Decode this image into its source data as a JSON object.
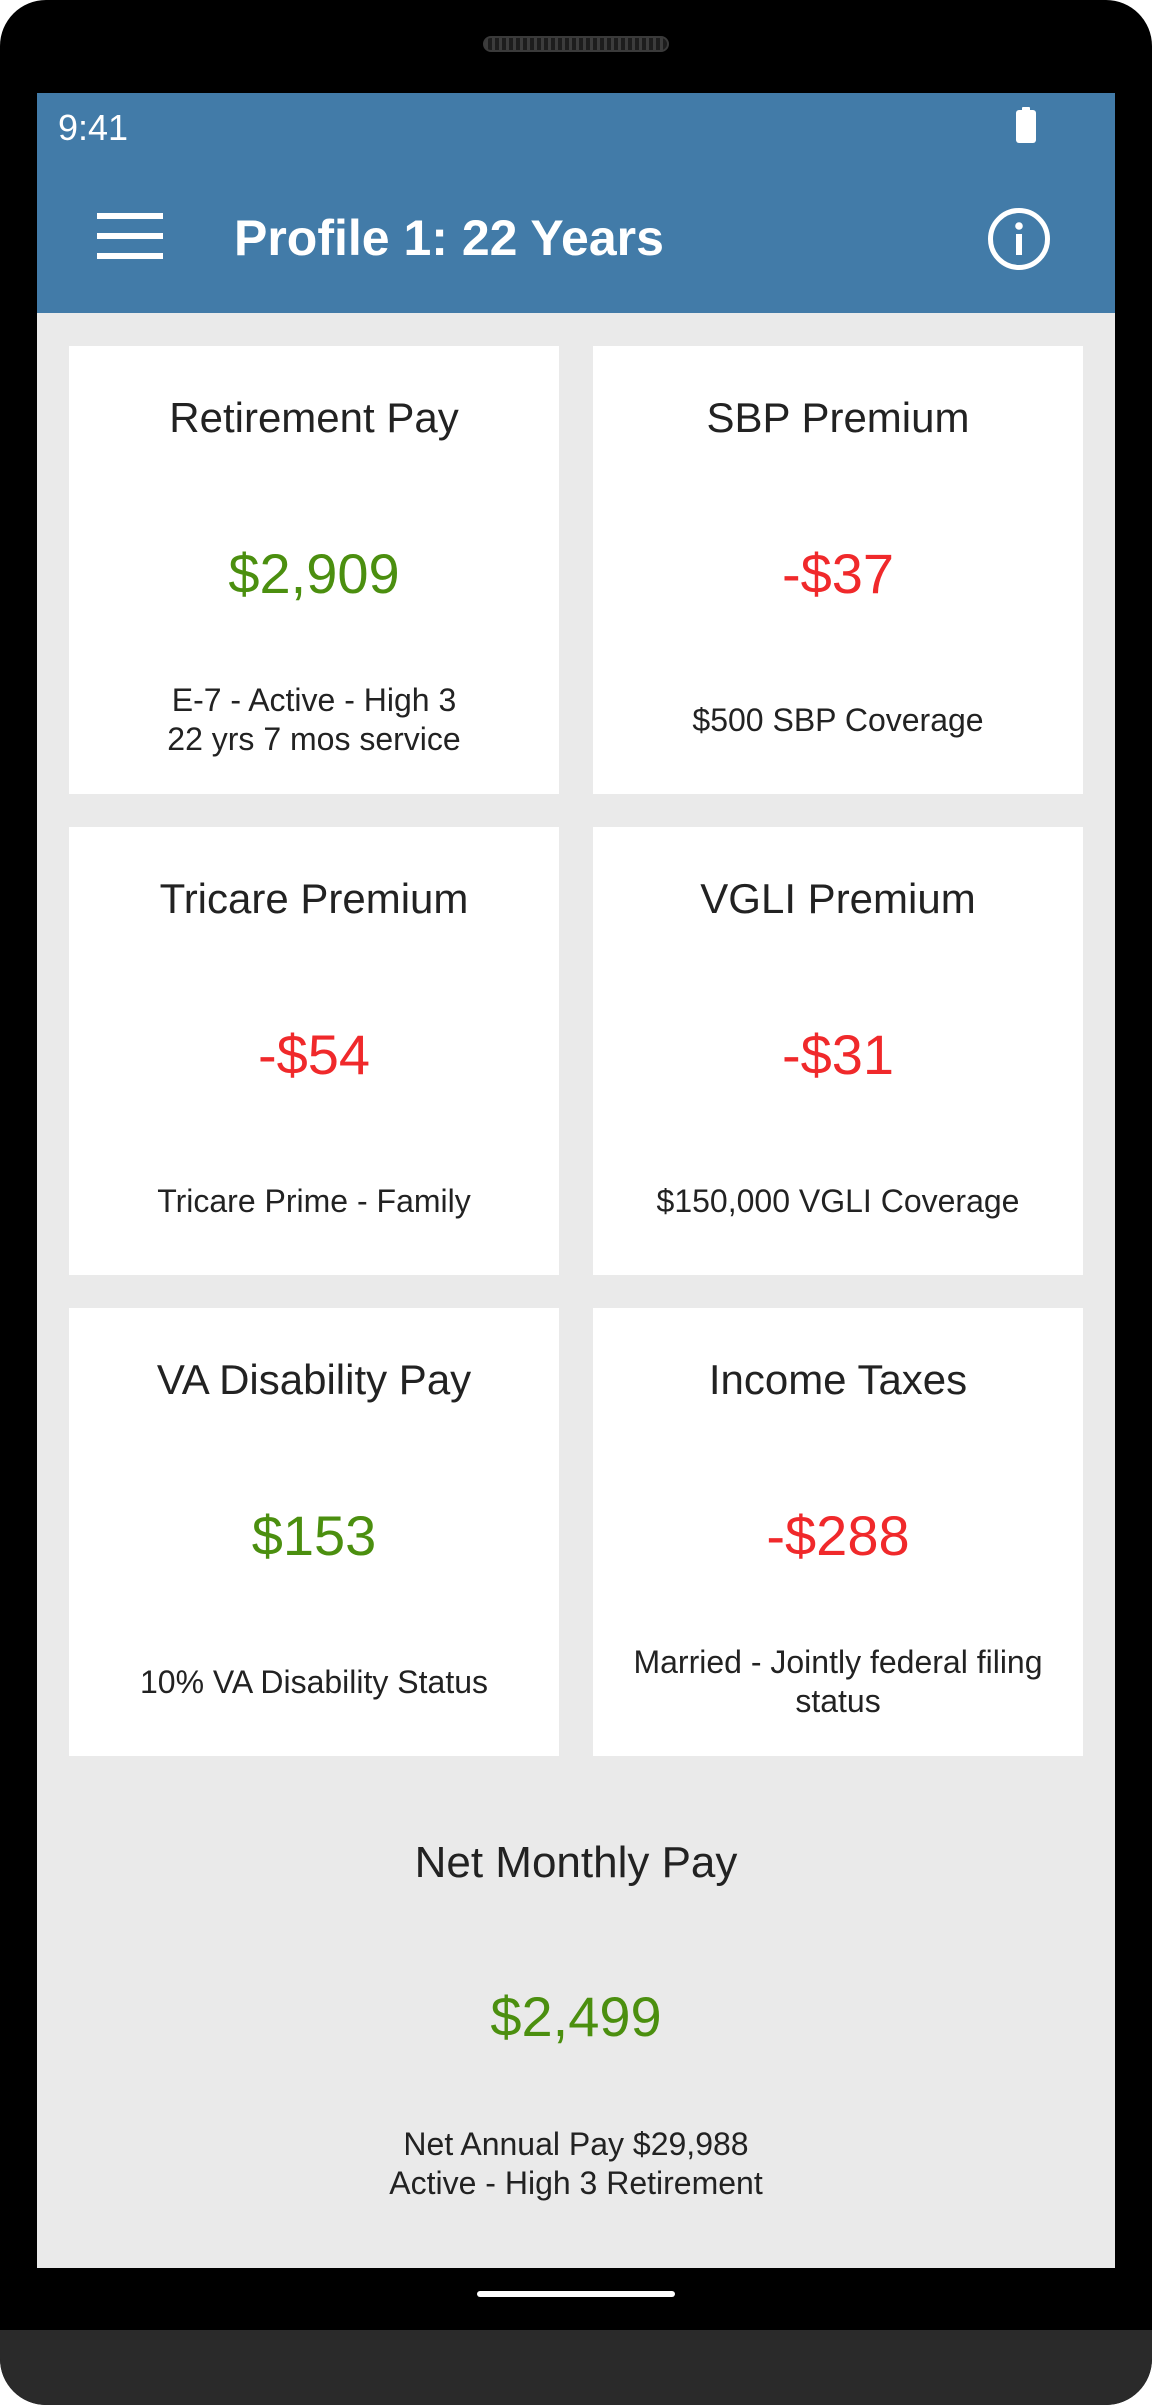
{
  "status_bar": {
    "time": "9:41"
  },
  "app_bar": {
    "title": "Profile 1: 22 Years"
  },
  "cards": [
    {
      "title": "Retirement Pay",
      "value": "$2,909",
      "sub_line1": "E-7 - Active - High 3",
      "sub_line2": "22 yrs 7 mos service"
    },
    {
      "title": "SBP Premium",
      "value": "-$37",
      "sub_line1": "$500 SBP Coverage"
    },
    {
      "title": "Tricare Premium",
      "value": "-$54",
      "sub_line1": "Tricare Prime - Family"
    },
    {
      "title": "VGLI Premium",
      "value": "-$31",
      "sub_line1": "$150,000 VGLI Coverage"
    },
    {
      "title": "VA Disability Pay",
      "value": "$153",
      "sub_line1": "10% VA Disability Status"
    },
    {
      "title": "Income Taxes",
      "value": "-$288",
      "sub_line1": "Married - Jointly federal filing",
      "sub_line2": "status"
    }
  ],
  "net": {
    "title": "Net Monthly Pay",
    "value": "$2,499",
    "sub_line1": "Net Annual Pay $29,988",
    "sub_line2": "Active - High 3 Retirement"
  },
  "colors": {
    "app_bar": "#427ba8",
    "positive": "#4b8f0f",
    "negative": "#f0292b",
    "background": "#eaeaea"
  }
}
